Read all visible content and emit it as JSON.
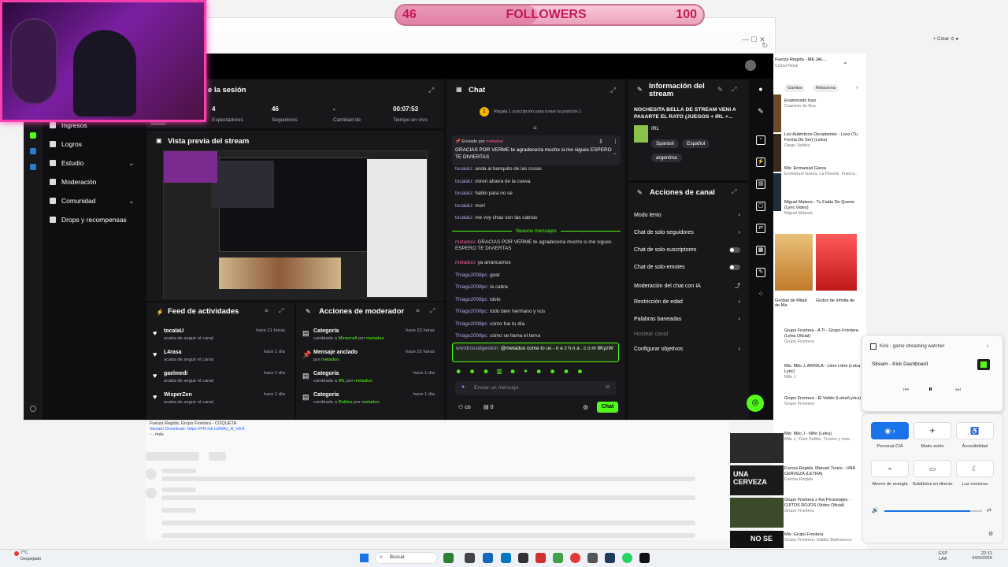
{
  "overlay": {
    "followers_current": "46",
    "followers_label": "FOLLOWERS",
    "followers_goal": "100",
    "followers_progress_fraction": 0.46
  },
  "header": {
    "session_title_partial": "e la sesión"
  },
  "session_stats": [
    {
      "value": "4",
      "label": "Espectadores"
    },
    {
      "value": "46",
      "label": "Seguidores"
    },
    {
      "value": "-",
      "label": "Cantidad de"
    },
    {
      "value": "00:07:53",
      "label": "Tiempo en vivo"
    }
  ],
  "session_label": "Sesión",
  "nav": {
    "items": [
      {
        "label": "Ingresos"
      },
      {
        "label": "Logros"
      },
      {
        "label": "Estudio",
        "chevron": "⌄"
      },
      {
        "label": "Moderación"
      },
      {
        "label": "Comunidad",
        "chevron": "⌄"
      },
      {
        "label": "Drops y recompensas"
      }
    ]
  },
  "preview": {
    "title": "Vista previa del stream"
  },
  "feed": {
    "title": "Feed de actividades",
    "items": [
      {
        "name": "tocalaU",
        "desc": "acaba de seguir el canal",
        "time": "hace 21 horas"
      },
      {
        "name": "L4rasa",
        "desc": "acaba de seguir el canal",
        "time": "hace 1 día"
      },
      {
        "name": "gaelmedi",
        "desc": "acaba de seguir el canal",
        "time": "hace 1 día"
      },
      {
        "name": "WisperZen",
        "desc": "acaba de seguir el canal",
        "time": "hace 1 día"
      }
    ]
  },
  "mod_actions": {
    "title": "Acciones de moderador",
    "items": [
      {
        "title": "Categoría",
        "desc_prefix": "cambiado a ",
        "desc_hl": "Minecraft",
        "desc_mid": " por ",
        "desc_user": "metaduo",
        "time": "hace 22 horas"
      },
      {
        "title": "Mensaje anclado",
        "desc_prefix": "por ",
        "desc_hl": "",
        "desc_mid": "",
        "desc_user": "metaduo",
        "time": "hace 22 horas"
      },
      {
        "title": "Categoría",
        "desc_prefix": "cambiado a ",
        "desc_hl": "IRL",
        "desc_mid": " por ",
        "desc_user": "metaduo",
        "time": "hace 1 día"
      },
      {
        "title": "Categoría",
        "desc_prefix": "cambiado a ",
        "desc_hl": "Roblox",
        "desc_mid": " por ",
        "desc_user": "metaduo",
        "time": "hace 1 día"
      }
    ]
  },
  "chat": {
    "title": "Chat",
    "gift_banner": "Regala 1 suscripción para tomar la posición 1",
    "pinned_by": "Enviado por",
    "pinned_text": "GRACIAS POR VERME te agradecería mucho si me sigues ESPERO TE DIVIERTAS",
    "new_messages": "Nuevos mensajes",
    "messages_before": [
      {
        "user": "tocalaU:",
        "text": "anda al banquito de las cosas"
      },
      {
        "user": "tocalaU:",
        "text": "miren afuera de la cueva"
      },
      {
        "user": "tocalaU:",
        "text": "hablo para no se"
      },
      {
        "user": "tocalaU:",
        "text": "morí"
      },
      {
        "user": "tocalaU:",
        "text": "me voy chau son las cabras"
      }
    ],
    "messages_after": [
      {
        "user": "metaduo:",
        "text": "GRACIAS POR VERME te agradecería mucho si me sigues ESPERO TE DIVIERTAS",
        "pink": true
      },
      {
        "user": "metaduo:",
        "text": "ya arrancamos",
        "pink": true
      },
      {
        "user": "Thiago2008pc:",
        "text": "goat"
      },
      {
        "user": "Thiago2008pc:",
        "text": "la cabra"
      },
      {
        "user": "Thiago2008pc:",
        "text": "idolo"
      },
      {
        "user": "Thiago2008pc:",
        "text": "todo bien hermano y vos"
      },
      {
        "user": "Thiago2008pc:",
        "text": "cómo fue tu día"
      },
      {
        "user": "Thiago2008pc:",
        "text": "cómo se llama el tema"
      }
    ],
    "highlighted": {
      "user": "wondrousdigestion:",
      "text": "@metaduo come to us - n e z h n a . c o m 8KyzW"
    },
    "input_placeholder": "Enviar un mensaje",
    "points_value": "0",
    "send_label": "Chat"
  },
  "stream_info": {
    "title": "Información del stream",
    "stream_title": "NOCHESITA BELLA DE STREAM VENI A PASARTE EL RATO (JUEGOS + IRL +...",
    "category": "IRL",
    "tags": [
      "Spanish",
      "Español",
      "argentina"
    ]
  },
  "channel_actions": {
    "title": "Acciones de canal",
    "items": [
      {
        "label": "Modo lento",
        "control": "chevron"
      },
      {
        "label": "Chat de solo-seguidores",
        "control": "chevron"
      },
      {
        "label": "Chat de solo-suscriptores",
        "control": "toggle"
      },
      {
        "label": "Chat de solo-emotes",
        "control": "toggle"
      },
      {
        "label": "Moderación del chat con IA",
        "control": "link"
      },
      {
        "label": "Restricción de edad",
        "control": "chevron"
      },
      {
        "label": "Palabras baneadas",
        "control": "chevron"
      },
      {
        "label": "Hostear canal",
        "control": "none",
        "muted": true
      },
      {
        "label": "Configurar objetivos",
        "control": "chevron"
      }
    ]
  },
  "youtube": {
    "now_playing": "Fuerza Regida - ME JAL...",
    "now_playing_sub": "Cortos/Tiktok",
    "chips": [
      "Gamba",
      "Relaciona"
    ],
    "items": [
      {
        "title": "Enamorado tuyo",
        "meta": "Cuarteto de Nos"
      },
      {
        "title": "Los Auténticos Decadentes - Loco (Tu Forma De Ser) (Letra)",
        "meta": "Diego Valdez"
      },
      {
        "title": "Mix: Enmanuel Garza",
        "meta": "Enmanuel Garza, La Rosete, Fuerza..."
      },
      {
        "title": "Miguel Mateos - Tu Falda De Querer (Lyric Video)",
        "meta": "Miguel Mateos"
      },
      {
        "title": "Mix: Grupo Frontera - Un x100to",
        "meta": "Grupo Frontera"
      },
      {
        "title": "Grupo Frontera - A Ti - Grupo Frontera (Letra Oficial)",
        "meta": "Grupo Frontera"
      },
      {
        "title": "Mix: Milo J, AKRIILA - Llore Libre (Letra / Lyric)",
        "meta": "Milo J"
      },
      {
        "title": "Grupo Frontera - El Valido (Letra/Lyrics)",
        "meta": "Grupo Frontera"
      },
      {
        "title": "Mix: Milo J - Niño (Letra)",
        "meta": "Milo J, Yami Safdie, Trueno y más"
      },
      {
        "title": "Fuerza Regida, Manuel Turizo - UNA CERVEZA (LETRA)",
        "meta": "Fuerza Regida"
      },
      {
        "title": "Grupo Frontera x Kei Personajes - OJITOS ROJOS (Video Oficial)",
        "meta": "Grupo Frontera"
      },
      {
        "title": "Mix: Grupo Frontera",
        "meta": "Grupo Frontera, Gabito Ballesteros"
      }
    ],
    "description_lines": [
      "Fuerza Regida, Grupo Frontera - COQUETA",
      "Stream Download: https://FR.lnk.to/MAJ_A_VEA",
      "··· más"
    ],
    "shorts": [
      {
        "label": "Gordas de Mitad de Ma"
      },
      {
        "label": "Godos de Infinita de"
      }
    ],
    "overlay_title_1": "UNA CERVEZA",
    "overlay_title_2": "NO SE"
  },
  "media_widget": {
    "app": "Kick - game streaming watcher",
    "title": "Stream - Kick Dashboard"
  },
  "quick_settings": {
    "tiles": [
      {
        "label": "Personal-CIA",
        "icon": "wifi-icon",
        "active": true
      },
      {
        "label": "Modo avión",
        "icon": "airplane-icon"
      },
      {
        "label": "Accesibilidad",
        "icon": "accessibility-icon"
      },
      {
        "label": "Ahorro de energía",
        "icon": "battery-icon"
      },
      {
        "label": "Subtítulos en directo",
        "icon": "captions-icon"
      },
      {
        "label": "Luz nocturna",
        "icon": "moon-icon"
      }
    ],
    "volume_fraction": 0.88
  },
  "taskbar": {
    "weather_temp": "7°C",
    "weather_text": "Despejado",
    "search_placeholder": "Buscar",
    "lang": "ESP LAA",
    "time": "22:11",
    "date": "24/5/2026"
  },
  "colors": {
    "kick_green": "#53fc18",
    "overlay_pink": "#c2185b",
    "webcam_border": "#ff3fb0",
    "windows_blue": "#1a73e8"
  }
}
